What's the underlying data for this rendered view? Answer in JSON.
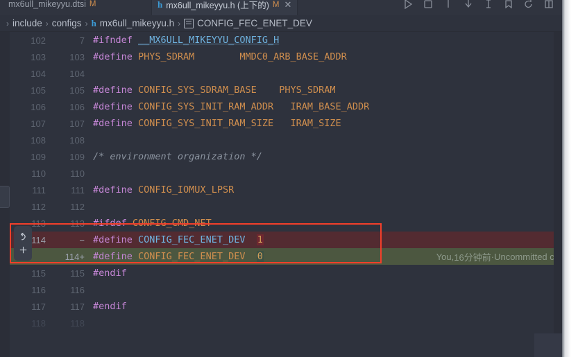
{
  "window": {
    "accent_red": "#f43f2a",
    "bg": "#2e323d"
  },
  "tabs": [
    {
      "label": "mx6ull_mikeyyu.dtsi",
      "modified_flag": "M",
      "active": false,
      "icon": "file-icon"
    },
    {
      "label": "mx6ull_mikeyyu.h (上下的)",
      "modified_flag": "M",
      "close": "✕",
      "active": true,
      "icon": "h-file-icon"
    }
  ],
  "toolbar": {
    "icons": [
      "run-icon",
      "stop-icon",
      "more-vert-icon",
      "download-icon",
      "beaker-icon",
      "bookmark-icon",
      "history-icon",
      "layout-icon"
    ],
    "overflow": "⋯"
  },
  "breadcrumb": {
    "separator": "›",
    "items": [
      {
        "label": "include",
        "icon": ""
      },
      {
        "label": "configs",
        "icon": ""
      },
      {
        "label": "mx6ull_mikeyyu.h",
        "icon": "h-file-icon"
      },
      {
        "label": "CONFIG_FEC_ENET_DEV",
        "icon": "struct-member-icon"
      }
    ]
  },
  "gutter_popup": {
    "revert_label": "revert-change",
    "add_label": "add-change"
  },
  "blame": {
    "author": "You,",
    "time": "16分钟前",
    "dot": "·",
    "message": "Uncommitted ch"
  },
  "code": {
    "lines": [
      {
        "old": "102",
        "new": "7",
        "marker": "",
        "kind": "normal",
        "faded": false,
        "tokens": [
          {
            "t": "#ifndef ",
            "c": "kw"
          },
          {
            "t": "__MX6ULL_MIKEYYU_CONFIG_H",
            "c": "ref"
          }
        ]
      },
      {
        "old": "103",
        "new": "103",
        "marker": "",
        "kind": "normal",
        "faded": false,
        "tokens": [
          {
            "t": "#define ",
            "c": "kw"
          },
          {
            "t": "PHYS_SDRAM",
            "c": "id"
          },
          {
            "t": "        ",
            "c": "plain"
          },
          {
            "t": "MMDC0_ARB_BASE_ADDR",
            "c": "id"
          }
        ]
      },
      {
        "old": "104",
        "new": "104",
        "marker": "",
        "kind": "normal",
        "faded": false,
        "tokens": []
      },
      {
        "old": "105",
        "new": "105",
        "marker": "",
        "kind": "normal",
        "faded": false,
        "tokens": [
          {
            "t": "#define ",
            "c": "kw"
          },
          {
            "t": "CONFIG_SYS_SDRAM_BASE",
            "c": "id"
          },
          {
            "t": "    ",
            "c": "plain"
          },
          {
            "t": "PHYS_SDRAM",
            "c": "id"
          }
        ]
      },
      {
        "old": "106",
        "new": "106",
        "marker": "",
        "kind": "normal",
        "faded": false,
        "tokens": [
          {
            "t": "#define ",
            "c": "kw"
          },
          {
            "t": "CONFIG_SYS_INIT_RAM_ADDR",
            "c": "id"
          },
          {
            "t": "   ",
            "c": "plain"
          },
          {
            "t": "IRAM_BASE_ADDR",
            "c": "id"
          }
        ]
      },
      {
        "old": "107",
        "new": "107",
        "marker": "",
        "kind": "normal",
        "faded": false,
        "tokens": [
          {
            "t": "#define ",
            "c": "kw"
          },
          {
            "t": "CONFIG_SYS_INIT_RAM_SIZE",
            "c": "id"
          },
          {
            "t": "   ",
            "c": "plain"
          },
          {
            "t": "IRAM_SIZE",
            "c": "id"
          }
        ]
      },
      {
        "old": "108",
        "new": "108",
        "marker": "",
        "kind": "normal",
        "faded": false,
        "tokens": []
      },
      {
        "old": "109",
        "new": "109",
        "marker": "",
        "kind": "normal",
        "faded": false,
        "tokens": [
          {
            "t": "/* environment organization */",
            "c": "cmt"
          }
        ]
      },
      {
        "old": "110",
        "new": "110",
        "marker": "",
        "kind": "normal",
        "faded": false,
        "tokens": []
      },
      {
        "old": "111",
        "new": "111",
        "marker": "",
        "kind": "normal",
        "faded": false,
        "tokens": [
          {
            "t": "#define ",
            "c": "kw"
          },
          {
            "t": "CONFIG_IOMUX_LPSR",
            "c": "id"
          }
        ]
      },
      {
        "old": "112",
        "new": "112",
        "marker": "",
        "kind": "normal",
        "faded": false,
        "tokens": []
      },
      {
        "old": "113",
        "new": "113",
        "marker": "",
        "kind": "normal",
        "faded": false,
        "tokens": [
          {
            "t": "#ifdef ",
            "c": "kw"
          },
          {
            "t": "CONFIG_CMD_NET",
            "c": "id"
          }
        ]
      },
      {
        "old": "114",
        "new": "",
        "marker": "−",
        "kind": "del",
        "faded": false,
        "tokens": [
          {
            "t": "#define ",
            "c": "kw"
          },
          {
            "t": "CONFIG_FEC_ENET_DEV",
            "c": "blue-id"
          },
          {
            "t": "  ",
            "c": "plain"
          },
          {
            "t": "1",
            "c": "num-del"
          }
        ]
      },
      {
        "old": "",
        "new": "114+",
        "marker": "",
        "kind": "add",
        "faded": false,
        "tokens": [
          {
            "t": "#define ",
            "c": "kw"
          },
          {
            "t": "CONFIG_FEC_ENET_DEV",
            "c": "id"
          },
          {
            "t": "  ",
            "c": "plain"
          },
          {
            "t": "0",
            "c": "num-add"
          }
        ]
      },
      {
        "old": "115",
        "new": "115",
        "marker": "",
        "kind": "normal",
        "faded": false,
        "tokens": [
          {
            "t": "#endif",
            "c": "kw"
          }
        ]
      },
      {
        "old": "116",
        "new": "116",
        "marker": "",
        "kind": "normal",
        "faded": false,
        "tokens": []
      },
      {
        "old": "117",
        "new": "117",
        "marker": "",
        "kind": "normal",
        "faded": false,
        "tokens": [
          {
            "t": "#endif",
            "c": "kw"
          }
        ]
      },
      {
        "old": "118",
        "new": "118",
        "marker": "",
        "kind": "normal",
        "faded": true,
        "tokens": []
      }
    ]
  }
}
